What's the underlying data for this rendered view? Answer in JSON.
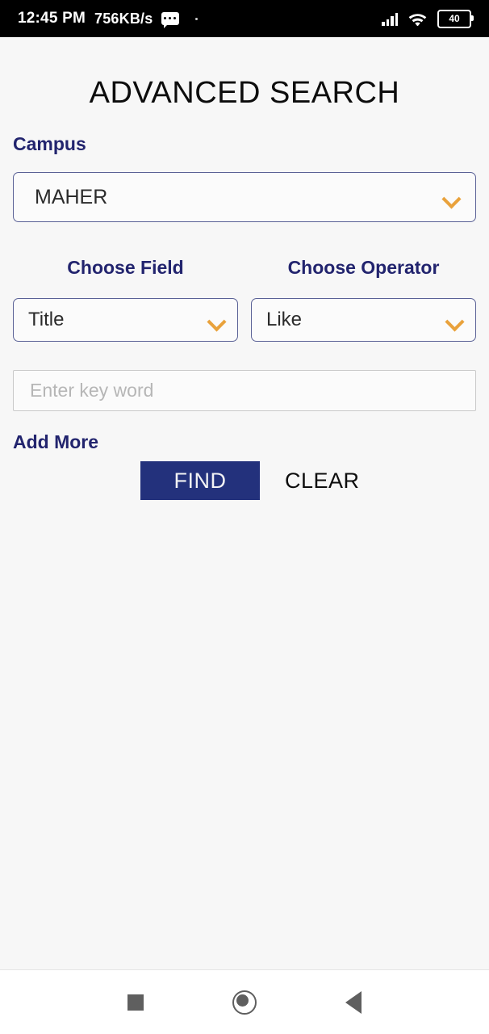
{
  "status_bar": {
    "clock": "12:45 PM",
    "network_speed": "756KB/s",
    "sms_icon": "message-icon",
    "signal_icon": "cellular-signal-icon",
    "wifi_icon": "wifi-icon",
    "battery_level": "40"
  },
  "page": {
    "title": "ADVANCED SEARCH"
  },
  "campus": {
    "label": "Campus",
    "value": "MAHER",
    "chevron_icon": "chevron-down-icon"
  },
  "field": {
    "label": "Choose Field",
    "value": "Title",
    "chevron_icon": "chevron-down-icon"
  },
  "operator": {
    "label": "Choose Operator",
    "value": "Like",
    "chevron_icon": "chevron-down-icon"
  },
  "keyword": {
    "placeholder": "Enter key word",
    "value": ""
  },
  "links": {
    "add_more": "Add More"
  },
  "actions": {
    "find": "FIND",
    "clear": "CLEAR"
  },
  "nav_bar": {
    "recents_icon": "square-recents-icon",
    "home_icon": "circle-home-icon",
    "back_icon": "triangle-back-icon"
  },
  "colors": {
    "accent_navy": "#22246e",
    "button_navy": "#23317c",
    "chevron_orange": "#e9a23c",
    "page_background": "#f7f7f7",
    "select_border": "#5a6196",
    "input_border": "#c9c9c9"
  }
}
